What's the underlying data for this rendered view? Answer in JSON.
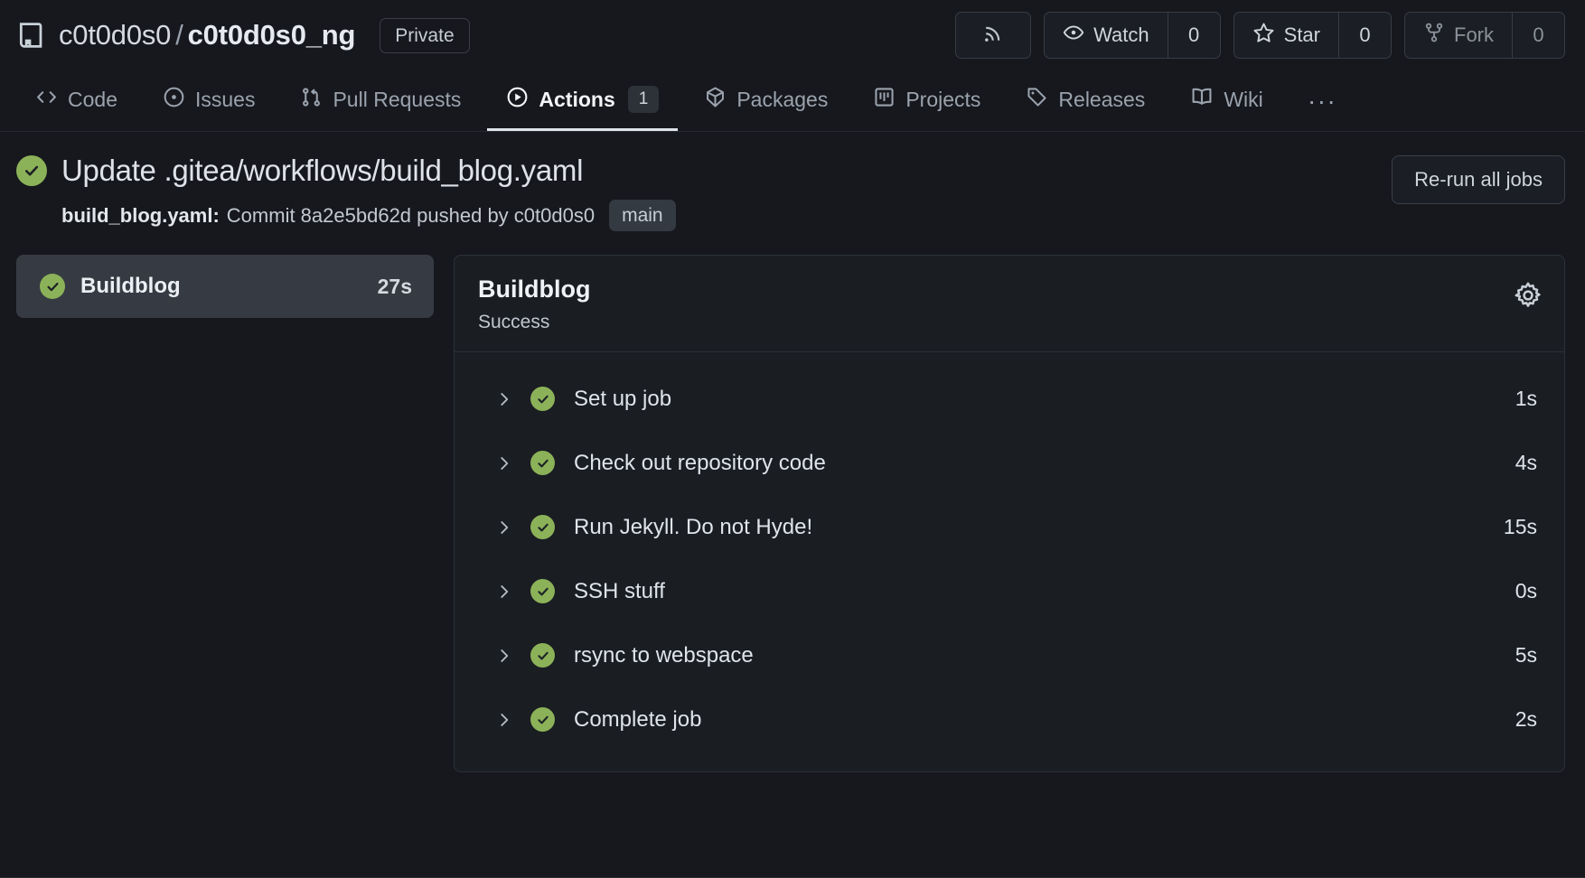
{
  "header": {
    "repo_icon": "repository-icon",
    "owner": "c0t0d0s0",
    "separator": "/",
    "name": "c0t0d0s0_ng",
    "visibility_badge": "Private",
    "actions": {
      "rss_icon": "rss-icon",
      "watch_label": "Watch",
      "watch_count": "0",
      "star_label": "Star",
      "star_count": "0",
      "fork_label": "Fork",
      "fork_count": "0"
    }
  },
  "nav": {
    "tabs": [
      {
        "label": "Code",
        "icon": "code-icon",
        "active": false,
        "badge": null
      },
      {
        "label": "Issues",
        "icon": "issue-opened-icon",
        "active": false,
        "badge": null
      },
      {
        "label": "Pull Requests",
        "icon": "git-pull-request-icon",
        "active": false,
        "badge": null
      },
      {
        "label": "Actions",
        "icon": "play-circle-icon",
        "active": true,
        "badge": "1"
      },
      {
        "label": "Packages",
        "icon": "package-icon",
        "active": false,
        "badge": null
      },
      {
        "label": "Projects",
        "icon": "project-icon",
        "active": false,
        "badge": null
      },
      {
        "label": "Releases",
        "icon": "tag-icon",
        "active": false,
        "badge": null
      },
      {
        "label": "Wiki",
        "icon": "book-icon",
        "active": false,
        "badge": null
      }
    ],
    "overflow_label": "..."
  },
  "run": {
    "status_icon": "check-circle-icon",
    "status_color": "#8cb259",
    "title": "Update .gitea/workflows/build_blog.yaml",
    "workflow_file": "build_blog.yaml:",
    "commit_text": "Commit 8a2e5bd62d pushed by c0t0d0s0",
    "branch": "main",
    "rerun_label": "Re-run all jobs"
  },
  "jobs": [
    {
      "name": "Buildblog",
      "duration": "27s",
      "status_icon": "check-circle-icon",
      "selected": true
    }
  ],
  "job_detail": {
    "title": "Buildblog",
    "status": "Success",
    "settings_icon": "gear-icon",
    "steps": [
      {
        "name": "Set up job",
        "duration": "1s",
        "status_icon": "check-circle-icon",
        "chevron": "chevron-right-icon"
      },
      {
        "name": "Check out repository code",
        "duration": "4s",
        "status_icon": "check-circle-icon",
        "chevron": "chevron-right-icon"
      },
      {
        "name": "Run Jekyll. Do not Hyde!",
        "duration": "15s",
        "status_icon": "check-circle-icon",
        "chevron": "chevron-right-icon"
      },
      {
        "name": "SSH stuff",
        "duration": "0s",
        "status_icon": "check-circle-icon",
        "chevron": "chevron-right-icon"
      },
      {
        "name": "rsync to webspace",
        "duration": "5s",
        "status_icon": "check-circle-icon",
        "chevron": "chevron-right-icon"
      },
      {
        "name": "Complete job",
        "duration": "2s",
        "status_icon": "check-circle-icon",
        "chevron": "chevron-right-icon"
      }
    ]
  }
}
